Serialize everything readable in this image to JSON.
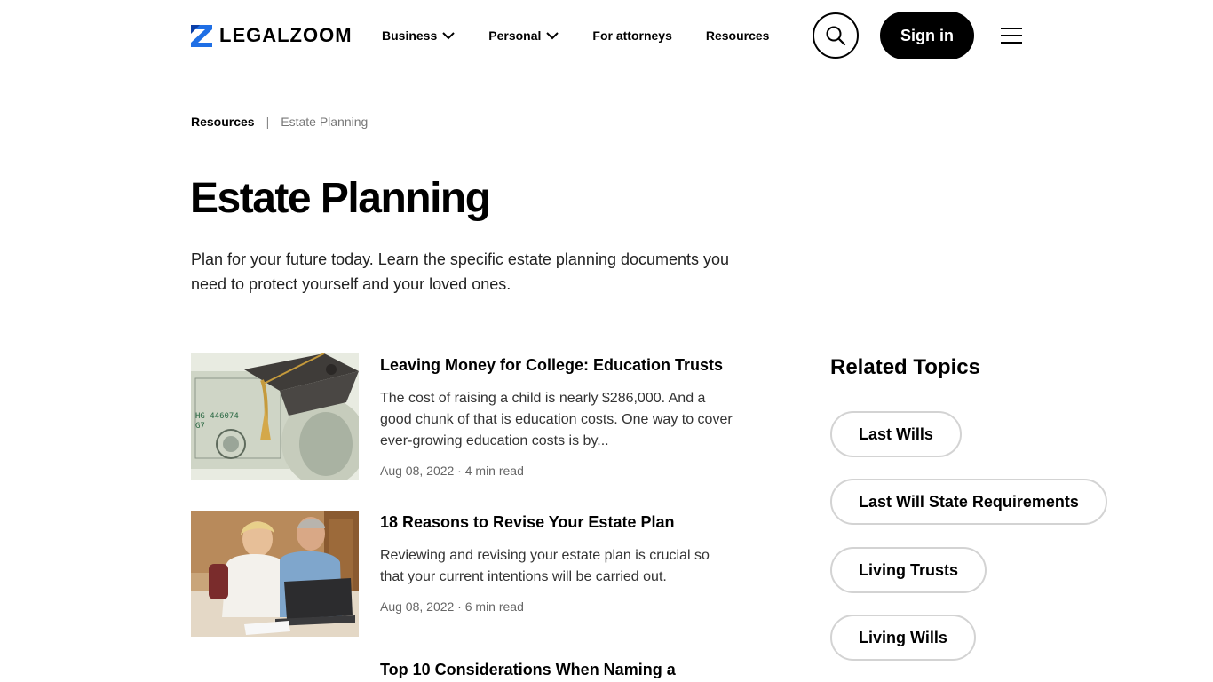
{
  "header": {
    "logo_text": "LEGALZOOM",
    "nav": [
      {
        "label": "Business",
        "dropdown": true
      },
      {
        "label": "Personal",
        "dropdown": true
      },
      {
        "label": "For attorneys",
        "dropdown": false
      },
      {
        "label": "Resources",
        "dropdown": false
      }
    ],
    "search_icon": "search-icon",
    "signin_label": "Sign in",
    "menu_icon": "hamburger-menu-icon"
  },
  "breadcrumb": {
    "parent": "Resources",
    "separator": "|",
    "current": "Estate Planning"
  },
  "page": {
    "title": "Estate Planning",
    "description": "Plan for your future today. Learn the specific estate planning documents you need to protect yourself and your loved ones."
  },
  "articles": [
    {
      "title": "Leaving Money for College: Education Trusts",
      "excerpt": "The cost of raising a child is nearly $286,000. And a good chunk of that is education costs. One way to cover ever-growing education costs is by...",
      "meta": "Aug 08, 2022 · 4 min read"
    },
    {
      "title": "18 Reasons to Revise Your Estate Plan",
      "excerpt": "Reviewing and revising your estate plan is crucial so that your current intentions will be carried out.",
      "meta": "Aug 08, 2022 · 6 min read"
    },
    {
      "title": "Top 10 Considerations When Naming a"
    }
  ],
  "related": {
    "title": "Related Topics",
    "topics": [
      "Last Wills",
      "Last Will State Requirements",
      "Living Trusts",
      "Living Wills"
    ]
  },
  "colors": {
    "primary": "#000000",
    "brand_blue": "#1f6fe5",
    "pill_border": "#d3d3d3"
  }
}
